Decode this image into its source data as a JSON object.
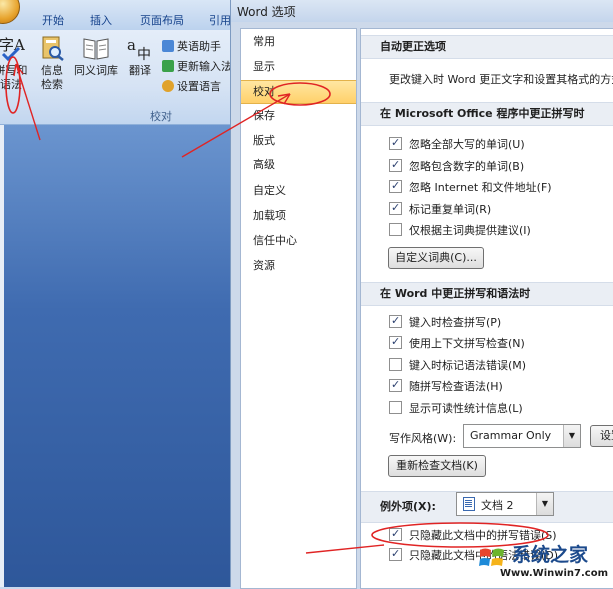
{
  "word": {
    "tabs": [
      "开始",
      "插入",
      "页面布局",
      "引用"
    ],
    "ribbon": {
      "proof_label_parts": [
        "拼写和",
        "语法"
      ],
      "info_label_parts": [
        "信息",
        "检索"
      ],
      "thesaurus_label": "同义词库",
      "translate_label": "翻译",
      "small_buttons": [
        "英语助手",
        "更新输入法",
        "设置语言"
      ],
      "group_label": "校对"
    }
  },
  "dialog": {
    "title": "Word 选项",
    "nav": [
      "常用",
      "显示",
      "校对",
      "保存",
      "版式",
      "高级",
      "自定义",
      "加载项",
      "信任中心",
      "资源"
    ],
    "selected_nav": "校对",
    "sections": {
      "autocorrect": {
        "title": "自动更正选项",
        "desc": "更改键入时 Word 更正文字和设置其格式的方式"
      },
      "office": {
        "title": "在 Microsoft Office 程序中更正拼写时",
        "options": [
          {
            "label": "忽略全部大写的单词(U)",
            "checked": true
          },
          {
            "label": "忽略包含数字的单词(B)",
            "checked": true
          },
          {
            "label": "忽略 Internet 和文件地址(F)",
            "checked": true
          },
          {
            "label": "标记重复单词(R)",
            "checked": true
          },
          {
            "label": "仅根据主词典提供建议(I)",
            "checked": false
          }
        ],
        "custom_dict_button": "自定义词典(C)..."
      },
      "word": {
        "title": "在 Word 中更正拼写和语法时",
        "options": [
          {
            "label": "键入时检查拼写(P)",
            "checked": true
          },
          {
            "label": "使用上下文拼写检查(N)",
            "checked": true
          },
          {
            "label": "键入时标记语法错误(M)",
            "checked": false
          },
          {
            "label": "随拼写检查语法(H)",
            "checked": true
          },
          {
            "label": "显示可读性统计信息(L)",
            "checked": false
          }
        ],
        "style_label": "写作风格(W):",
        "style_value": "Grammar Only",
        "settings_button": "设置",
        "recheck_button": "重新检查文档(K)"
      },
      "exceptions": {
        "label": "例外项(X):",
        "doc_value": "文档 2",
        "options": [
          {
            "label": "只隐藏此文档中的拼写错误(S)",
            "checked": true
          },
          {
            "label": "只隐藏此文档中的语法错误(D)",
            "checked": true
          }
        ]
      }
    }
  },
  "watermark": {
    "title": "系统之家",
    "url": "Www.Winwin7.com"
  },
  "colors": {
    "annotation_red": "#e02424",
    "selected_nav": "#ffd06a",
    "section_bg": "#eaeef4"
  }
}
